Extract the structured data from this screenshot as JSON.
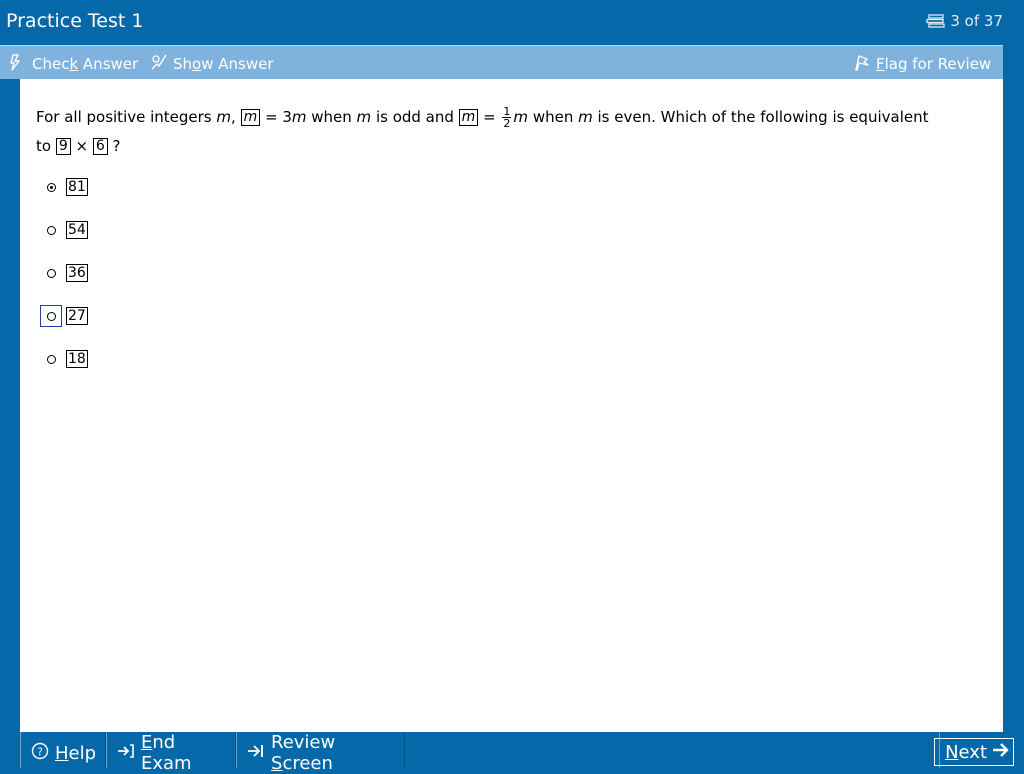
{
  "app": {
    "title": "Practice Test 1"
  },
  "progress": {
    "label": "3 of 37",
    "icon": "stack-icon"
  },
  "toolbar": {
    "check_answer": {
      "pre": "Chec",
      "ul": "k",
      "post": " Answer",
      "icon": "check-pen-icon"
    },
    "show_answer": {
      "pre": "Sh",
      "ul": "o",
      "post": "w Answer",
      "icon": "show-pen-icon"
    },
    "flag": {
      "pre": "",
      "ul": "F",
      "post": "lag for Review",
      "icon": "flag-icon"
    }
  },
  "question": {
    "p1": "For all positive integers ",
    "var_m": "m",
    "comma": ",",
    "box_m": "m",
    "eq1": " = 3",
    "p2": " when ",
    "p3": " is odd and ",
    "eq2": " = ",
    "frac_num": "1",
    "frac_den": "2",
    "p4": " when ",
    "p5": " is even.  Which of the following is equivalent",
    "to": "to ",
    "box_9": "9",
    "times": " × ",
    "box_6": "6",
    "qmark": " ?"
  },
  "choices": [
    {
      "label": "81",
      "selected": true,
      "focused": false
    },
    {
      "label": "54",
      "selected": false,
      "focused": false
    },
    {
      "label": "36",
      "selected": false,
      "focused": false
    },
    {
      "label": "27",
      "selected": false,
      "focused": true
    },
    {
      "label": "18",
      "selected": false,
      "focused": false
    }
  ],
  "footer": {
    "help": {
      "pre": "",
      "ul": "H",
      "post": "elp",
      "icon": "help-circle-icon"
    },
    "end_exam": {
      "pre": "",
      "ul": "E",
      "post": "nd Exam",
      "icon": "exit-arrow-icon"
    },
    "review": {
      "pre": "Review ",
      "ul": "S",
      "post": "creen",
      "icon": "review-arrow-icon"
    },
    "next": {
      "pre": "",
      "ul": "N",
      "post": "ext",
      "icon": "right-arrow-icon"
    }
  },
  "colors": {
    "brand_blue": "#0568a8",
    "toolbar_blue": "#7fb3de",
    "focus": "#2a3c9c"
  }
}
